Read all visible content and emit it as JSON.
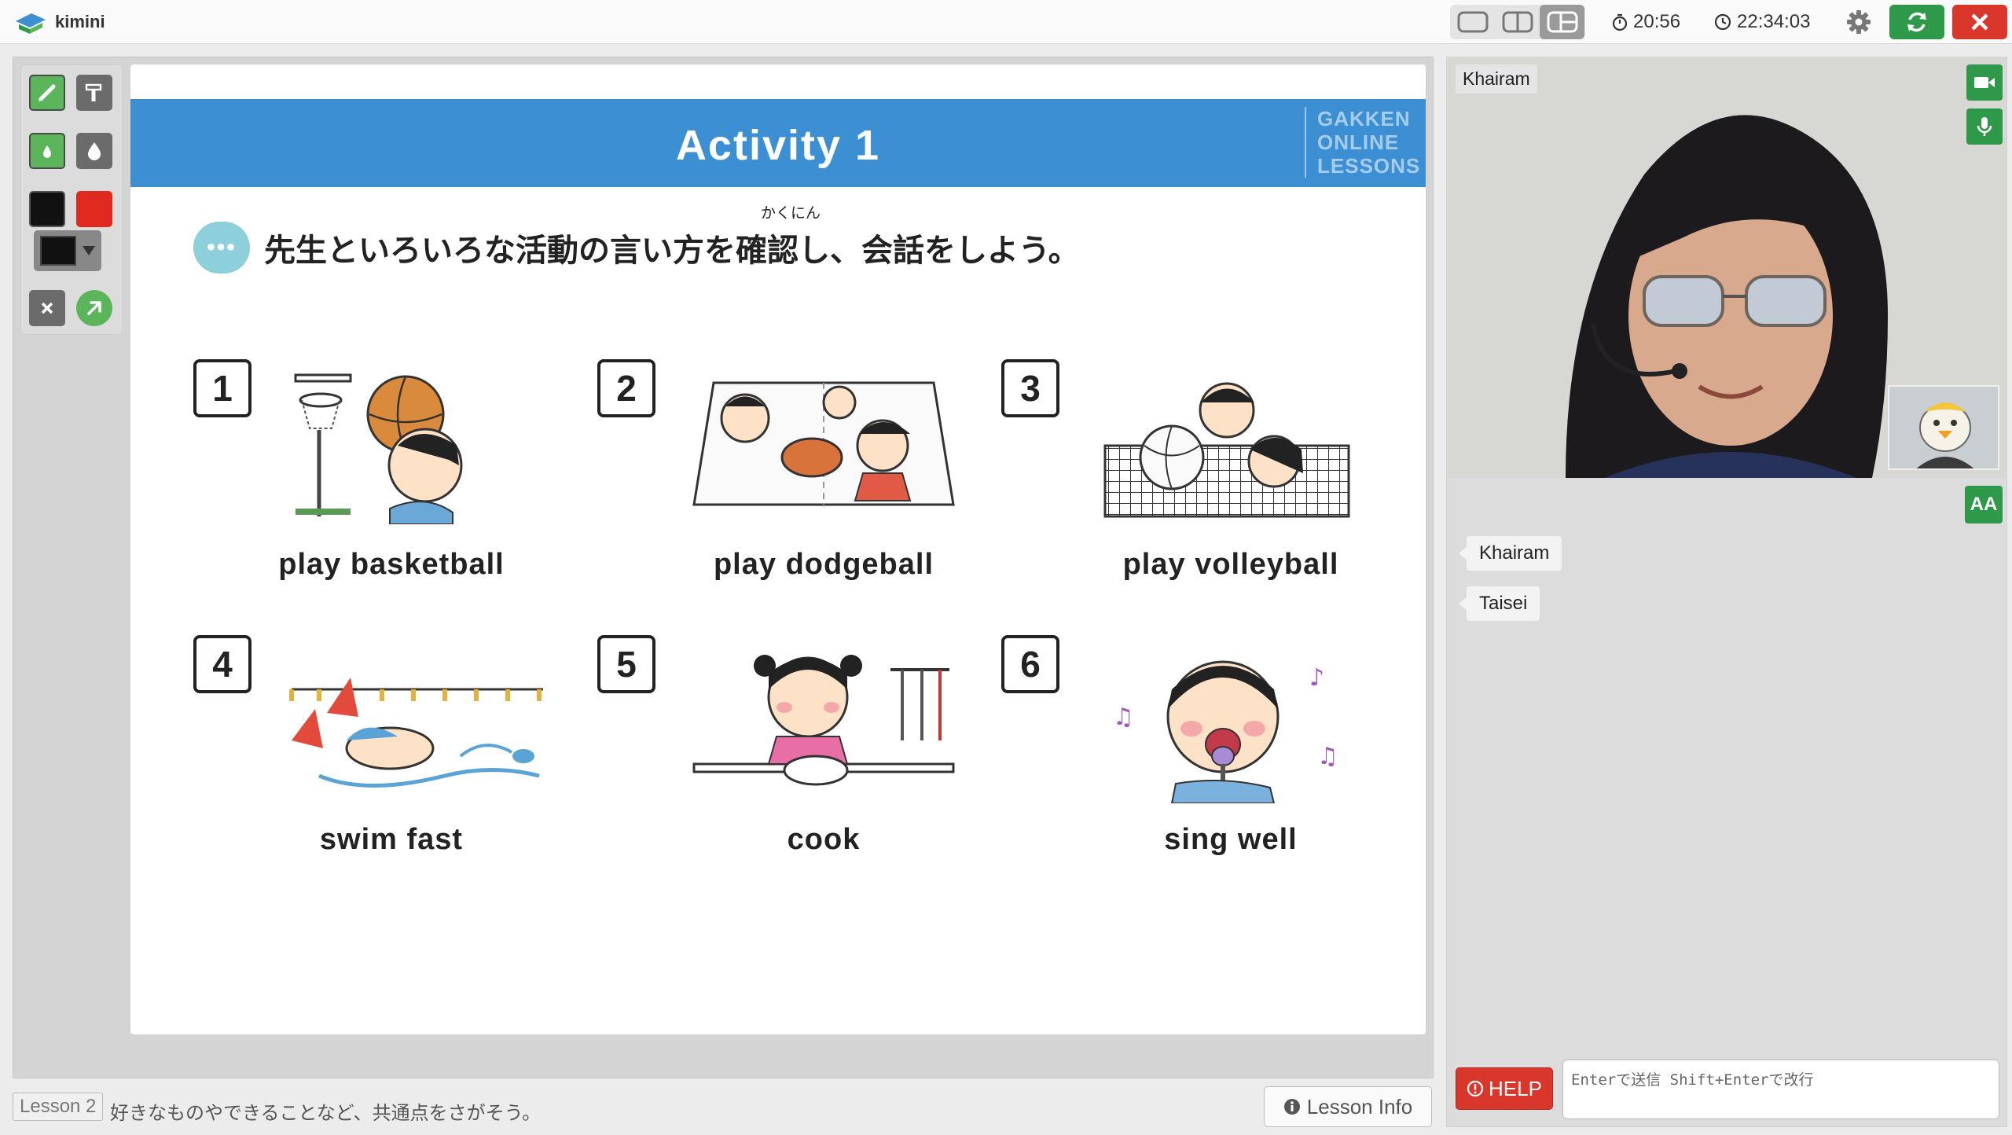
{
  "app": {
    "brand": "kimini"
  },
  "topbar": {
    "timer": "20:56",
    "clock": "22:34:03",
    "colors": {
      "green": "#2e9a49",
      "red": "#d9372b"
    }
  },
  "toolbox": {
    "tools": [
      {
        "name": "pen-icon"
      },
      {
        "name": "highlighter-icon"
      },
      {
        "name": "small-drop-icon"
      },
      {
        "name": "large-drop-icon"
      },
      {
        "name": "black-swatch",
        "color": "#111111"
      },
      {
        "name": "red-swatch",
        "color": "#e02a1f"
      },
      {
        "name": "color-select",
        "color": "#111111"
      },
      {
        "name": "clear-icon"
      },
      {
        "name": "arrow-icon"
      }
    ]
  },
  "slide": {
    "title": "Activity 1",
    "logo_lines": [
      "GAKKEN",
      "ONLINE",
      "LESSONS"
    ],
    "instruction": "先生といろいろな活動の言い方を確認し、会話をしよう。",
    "ruby": "かくにん",
    "activities": [
      {
        "number": "1",
        "label": "play basketball"
      },
      {
        "number": "2",
        "label": "play dodgeball"
      },
      {
        "number": "3",
        "label": "play volleyball"
      },
      {
        "number": "4",
        "label": "swim fast"
      },
      {
        "number": "5",
        "label": "cook"
      },
      {
        "number": "6",
        "label": "sing well"
      }
    ]
  },
  "bottom": {
    "lesson_tag": "Lesson 2",
    "lesson_description": "好きなものやできることなど、共通点をさがそう。",
    "lesson_info_label": "Lesson Info"
  },
  "video": {
    "participant_name": "Khairam"
  },
  "chat": {
    "aa_label": "AA",
    "messages": [
      {
        "author": "Khairam"
      },
      {
        "author": "Taisei"
      }
    ],
    "help_label": "HELP",
    "input_placeholder": "Enterで送信 Shift+Enterで改行"
  }
}
